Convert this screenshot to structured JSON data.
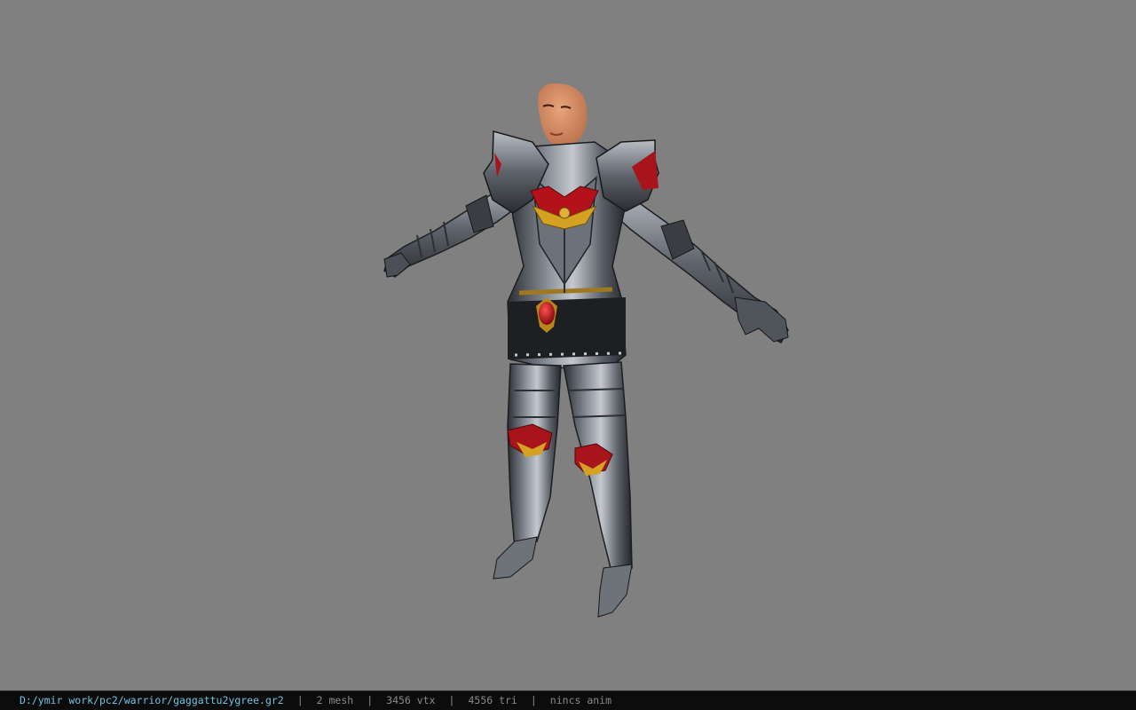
{
  "window": {
    "background_color": "#808080"
  },
  "viewport": {
    "model_name": "armored-warrior-female-model"
  },
  "status_bar": {
    "file_path": "D:/ymir work/pc2/warrior/gaggattu2ygree.gr2",
    "separator": "|",
    "mesh_count": "2 mesh",
    "vertex_count": "3456 vtx",
    "triangle_count": "4556 tri",
    "animation_status": "nincs anim",
    "path_color": "#6fc3e0",
    "text_color": "#8a8a8a"
  }
}
